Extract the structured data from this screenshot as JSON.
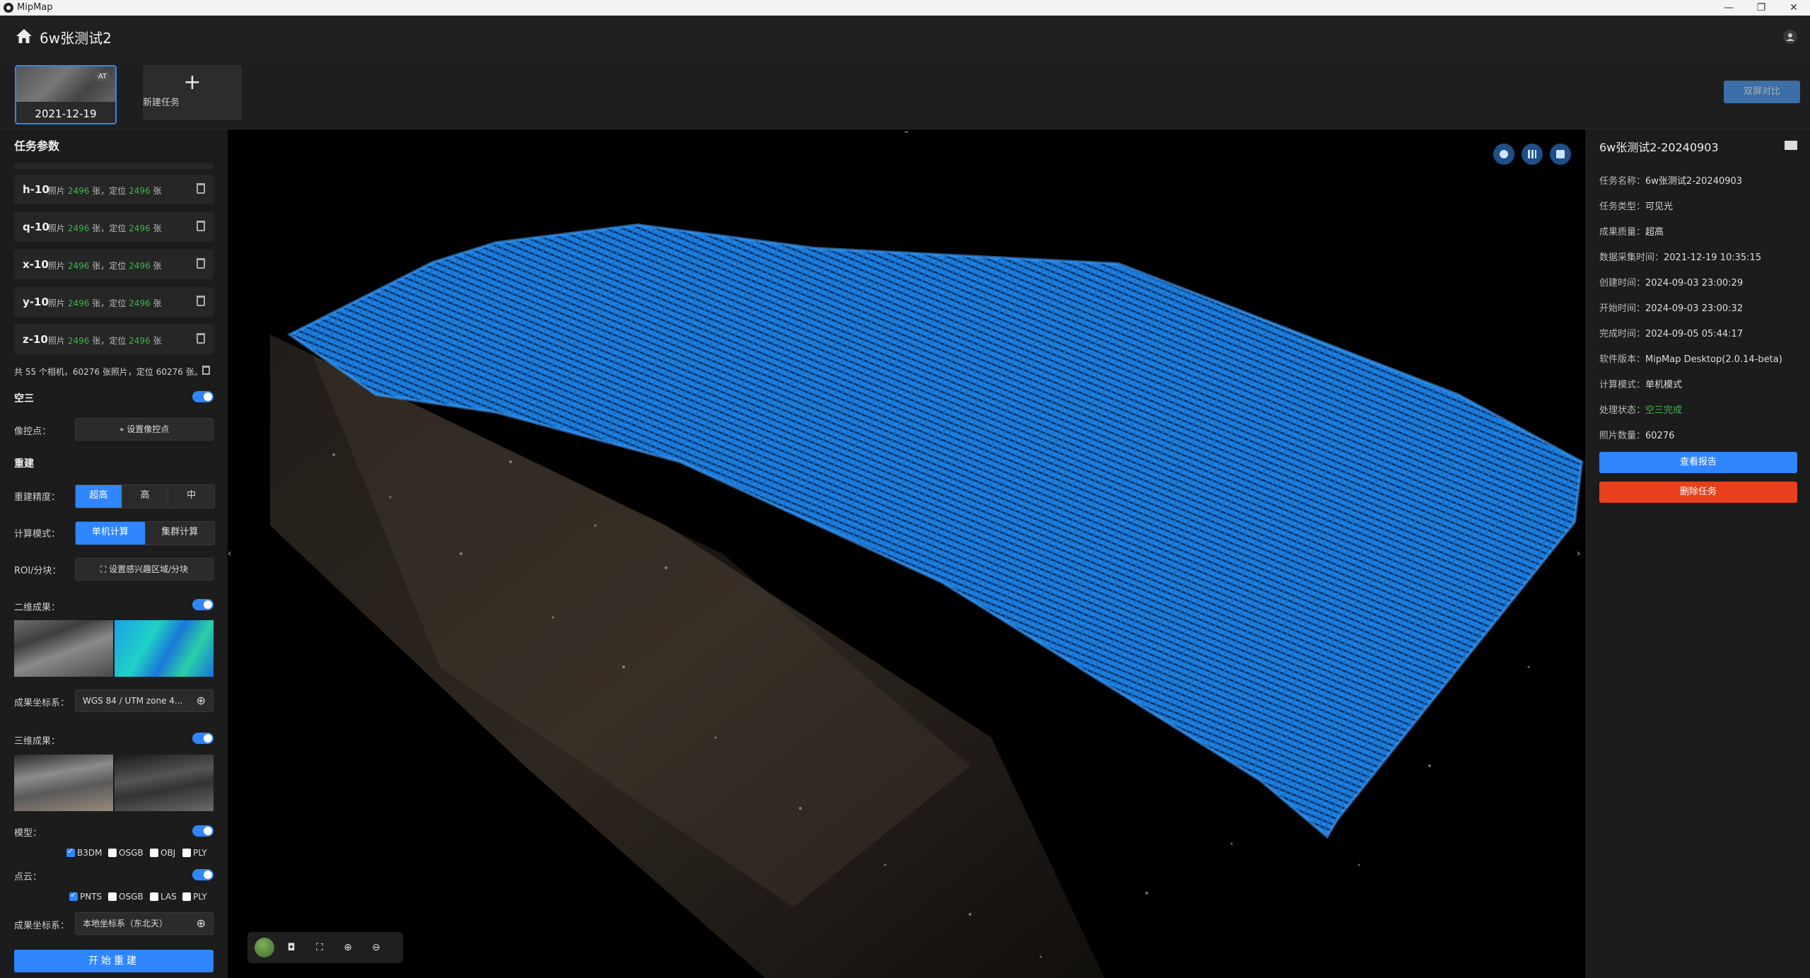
{
  "window": {
    "app_name": "MipMap",
    "minimize": "—",
    "maximize": "❐",
    "close": "✕"
  },
  "header": {
    "project_name": "6w张测试2"
  },
  "tasks": [
    {
      "date": "2021-12-19",
      "badge": "AT"
    }
  ],
  "new_task_label": "新建任务",
  "compare_label": "双屏对比",
  "left": {
    "title": "任务参数",
    "cameras": [
      {
        "name": "h-10",
        "photos": "2496",
        "positions": "2496"
      },
      {
        "name": "q-10",
        "photos": "2496",
        "positions": "2496"
      },
      {
        "name": "x-10",
        "photos": "2496",
        "positions": "2496"
      },
      {
        "name": "y-10",
        "photos": "2496",
        "positions": "2496"
      },
      {
        "name": "z-10",
        "photos": "2496",
        "positions": "2496"
      }
    ],
    "camera_info_prefix": "照片",
    "camera_info_mid": "张，定位",
    "camera_info_suffix": "张",
    "summary": "共 55 个相机，60276 张照片，定位 60276 张。",
    "aerial_label": "空三",
    "gcp_label": "像控点：",
    "gcp_button": "设置像控点",
    "recon_label": "重建",
    "precision_label": "重建精度：",
    "precision_options": [
      "超高",
      "高",
      "中"
    ],
    "compute_label": "计算模式：",
    "compute_options": [
      "单机计算",
      "集群计算"
    ],
    "roi_label": "ROI/分块：",
    "roi_button": "设置感兴趣区域/分块",
    "result_2d_label": "二维成果：",
    "crs_label": "成果坐标系：",
    "crs_2d_value": "WGS 84 / UTM zone 4...",
    "result_3d_label": "三维成果：",
    "model_label": "模型：",
    "model_formats": [
      {
        "name": "B3DM",
        "checked": true
      },
      {
        "name": "OSGB",
        "checked": false
      },
      {
        "name": "OBJ",
        "checked": false
      },
      {
        "name": "PLY",
        "checked": false
      }
    ],
    "pointcloud_label": "点云：",
    "pointcloud_formats": [
      {
        "name": "PNTS",
        "checked": true
      },
      {
        "name": "OSGB",
        "checked": false
      },
      {
        "name": "LAS",
        "checked": false
      },
      {
        "name": "PLY",
        "checked": false
      }
    ],
    "crs_3d_value": "本地坐标系（东北天）",
    "start_button": "开始重建"
  },
  "right": {
    "title": "6w张测试2-20240903",
    "fields": [
      {
        "key": "任务名称：",
        "value": "6w张测试2-20240903"
      },
      {
        "key": "任务类型：",
        "value": "可见光"
      },
      {
        "key": "成果质量：",
        "value": "超高"
      },
      {
        "key": "数据采集时间：",
        "value": "2021-12-19 10:35:15"
      },
      {
        "key": "创建时间：",
        "value": "2024-09-03 23:00:29"
      },
      {
        "key": "开始时间：",
        "value": "2024-09-03 23:00:32"
      },
      {
        "key": "完成时间：",
        "value": "2024-09-05 05:44:17"
      },
      {
        "key": "软件版本：",
        "value": "MipMap Desktop(2.0.14-beta)"
      },
      {
        "key": "计算模式：",
        "value": "单机模式"
      },
      {
        "key": "处理状态：",
        "value": "空三完成",
        "status": "green"
      },
      {
        "key": "照片数量：",
        "value": "60276"
      }
    ],
    "report_button": "查看报告",
    "delete_button": "删除任务"
  },
  "colors": {
    "accent": "#2f86ff",
    "danger": "#e8401c",
    "success": "#3bb54a",
    "points": "#1e90ff"
  }
}
